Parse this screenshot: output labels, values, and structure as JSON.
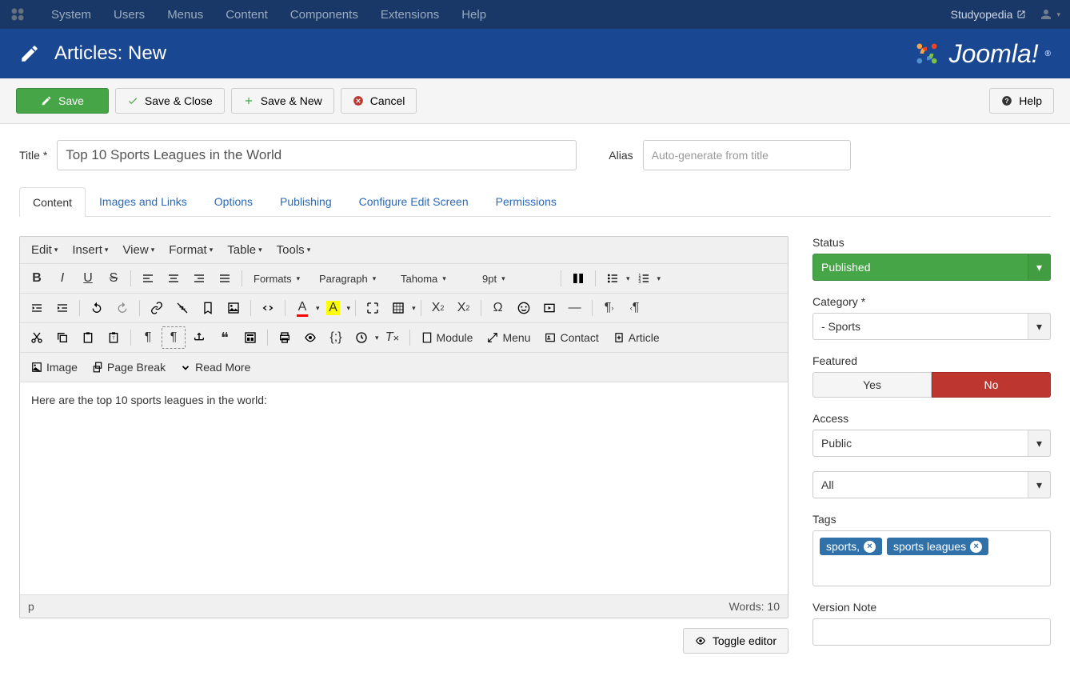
{
  "topbar": {
    "menus": [
      "System",
      "Users",
      "Menus",
      "Content",
      "Components",
      "Extensions",
      "Help"
    ],
    "site_name": "Studyopedia"
  },
  "header": {
    "title": "Articles: New",
    "brand": "Joomla!"
  },
  "toolbar": {
    "save": "Save",
    "save_close": "Save & Close",
    "save_new": "Save & New",
    "cancel": "Cancel",
    "help": "Help"
  },
  "form": {
    "title_label": "Title *",
    "title_value": "Top 10 Sports Leagues in the World",
    "alias_label": "Alias",
    "alias_placeholder": "Auto-generate from title"
  },
  "tabs": [
    "Content",
    "Images and Links",
    "Options",
    "Publishing",
    "Configure Edit Screen",
    "Permissions"
  ],
  "editor": {
    "menus": [
      "Edit",
      "Insert",
      "View",
      "Format",
      "Table",
      "Tools"
    ],
    "formats_label": "Formats",
    "block_label": "Paragraph",
    "font_label": "Tahoma",
    "size_label": "9pt",
    "btn_module": "Module",
    "btn_menu": "Menu",
    "btn_contact": "Contact",
    "btn_article": "Article",
    "btn_image": "Image",
    "btn_pagebreak": "Page Break",
    "btn_readmore": "Read More",
    "body_text": "Here are the top 10 sports leagues in the world:",
    "path": "p",
    "words_label": "Words: 10",
    "toggle": "Toggle editor"
  },
  "sidebar": {
    "status_label": "Status",
    "status_value": "Published",
    "category_label": "Category *",
    "category_value": "- Sports",
    "featured_label": "Featured",
    "featured_yes": "Yes",
    "featured_no": "No",
    "access_label": "Access",
    "access_value": "Public",
    "language_value": "All",
    "tags_label": "Tags",
    "tags": [
      "sports,",
      "sports leagues"
    ],
    "version_label": "Version Note"
  }
}
